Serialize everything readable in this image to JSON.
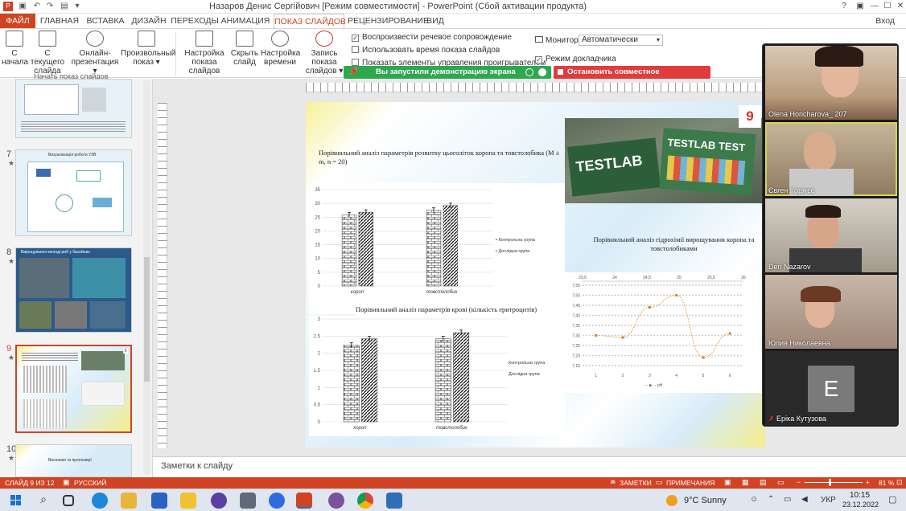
{
  "window": {
    "title": "Назаров Денис Сергійович [Режим совместимости] - PowerPoint (Сбой активации продукта)",
    "login": "Вход",
    "help": "?"
  },
  "tabs": [
    "ФАЙЛ",
    "ГЛАВНАЯ",
    "ВСТАВКА",
    "ДИЗАЙН",
    "ПЕРЕХОДЫ",
    "АНИМАЦИЯ",
    "ПОКАЗ СЛАЙДОВ",
    "РЕЦЕНЗИРОВАНИЕ",
    "ВИД"
  ],
  "ribbon": {
    "buttons": [
      {
        "label1": "С",
        "label2": "начала"
      },
      {
        "label1": "С текущего",
        "label2": "слайда"
      },
      {
        "label1": "Онлайн-",
        "label2": "презентация ▾"
      },
      {
        "label1": "Произвольный",
        "label2": "показ ▾"
      },
      {
        "label1": "Настройка",
        "label2": "показа слайдов"
      },
      {
        "label1": "Скрыть",
        "label2": "слайд"
      },
      {
        "label1": "Настройка",
        "label2": "времени"
      },
      {
        "label1": "Запись показа",
        "label2": "слайдов ▾"
      }
    ],
    "group_start": "Начать показ слайдов",
    "checks": [
      {
        "label": "Воспроизвести речевое сопровождение",
        "checked": true
      },
      {
        "label": "Использовать время показа слайдов",
        "checked": false
      },
      {
        "label": "Показать элементы управления проигрывателем",
        "checked": false
      }
    ],
    "monitor_label": "Монитор:",
    "monitor_value": "Автоматически",
    "presenter_mode": "Режим докладчика"
  },
  "sharing": {
    "active_text": "Вы запустили демонстрацию экрана",
    "stop_text": "Остановить совместное использование"
  },
  "thumbnails": [
    {
      "num": "7",
      "title": "Визуализація роботи УЗВ"
    },
    {
      "num": "8",
      "title": "Вирощування молоді риб у басейнах"
    },
    {
      "num": "9",
      "title": ""
    },
    {
      "num": "10",
      "title": "Висновки та пропозиції"
    }
  ],
  "slide": {
    "number": "9",
    "chart1_title": "Порівняльний аналіз параметрів розвитку цьоголіток коропа та товстолобика (M ± m, n = 20)",
    "chart2_title": "Порівняльний аналіз параметрів крові (кількість еритроцитів) цьоголіток коропа та товстолобика (M ± m, n = 20)",
    "chart3_title": "Порівняльний аналіз гідрохімії вирощування коропа та товстолобиками",
    "legend_control": "Контрольна група",
    "legend_exp": "Дослідна група",
    "photo_label1": "TESTLAB",
    "photo_label2": "TESTLAB TEST",
    "series3_name": "pH"
  },
  "chart_data": [
    {
      "type": "bar",
      "title": "Порівняльний аналіз параметрів розвитку цьоголіток коропа та товстолобика (M ± m, n = 20)",
      "categories": [
        "короп",
        "товстолобик"
      ],
      "series": [
        {
          "name": "Контрольна група",
          "values": [
            25.8,
            27.5
          ]
        },
        {
          "name": "Дослідна група",
          "values": [
            26.8,
            29.2
          ]
        }
      ],
      "ylim": [
        0,
        35
      ],
      "yticks": [
        0,
        5,
        10,
        15,
        20,
        25,
        30,
        35
      ]
    },
    {
      "type": "bar",
      "title": "Порівняльний аналіз параметрів крові (кількість еритроцитів) цьоголіток коропа та товстолобика (M ± m, n = 20)",
      "categories": [
        "короп",
        "товстолобик"
      ],
      "series": [
        {
          "name": "Контрольна група",
          "values": [
            2.23,
            2.42
          ]
        },
        {
          "name": "Дослідна група",
          "values": [
            2.42,
            2.6
          ]
        }
      ],
      "ylim": [
        0,
        3
      ],
      "yticks": [
        0,
        0.5,
        1,
        1.5,
        2,
        2.5,
        3
      ]
    },
    {
      "type": "line",
      "title": "Порівняльний аналіз гідрохімії вирощування коропа та товстолобиками",
      "x": [
        1,
        2,
        3,
        4,
        5,
        6
      ],
      "series": [
        {
          "name": "pH",
          "values": [
            7.3,
            7.29,
            7.44,
            7.5,
            7.19,
            7.31
          ]
        }
      ],
      "ylim": [
        7.15,
        7.55
      ],
      "yticks": [
        7.15,
        7.2,
        7.25,
        7.3,
        7.35,
        7.4,
        7.45,
        7.5,
        7.55
      ],
      "x2ticks": [
        "23,5",
        "24",
        "24,5",
        "25",
        "25,5",
        "26"
      ]
    }
  ],
  "participants": [
    {
      "name": "Olena Honcharova_ 207",
      "bg": "#b99a7c"
    },
    {
      "name": "Євген Коржєє",
      "bg": "#8d7a62"
    },
    {
      "name": "Den Nazarov",
      "bg": "#a39a8c"
    },
    {
      "name": "Юлия Николаевна",
      "bg": "#9f8878"
    },
    {
      "name": "Еріка Кутузова",
      "initial": "E",
      "bg": "#2a2a2a"
    }
  ],
  "notes_placeholder": "Заметки к слайду",
  "status": {
    "slide_info": "СЛАЙД 9 ИЗ 12",
    "language": "РУССКИЙ",
    "notes": "ЗАМЕТКИ",
    "comments": "ПРИМЕЧАНИЯ",
    "zoom": "81 %"
  },
  "taskbar": {
    "weather": "9°C  Sunny",
    "lang": "УКР",
    "time": "10:15",
    "date": "23.12.2022"
  },
  "colors": {
    "accent": "#d04423",
    "green": "#2ea84f",
    "red": "#e03c3c"
  }
}
